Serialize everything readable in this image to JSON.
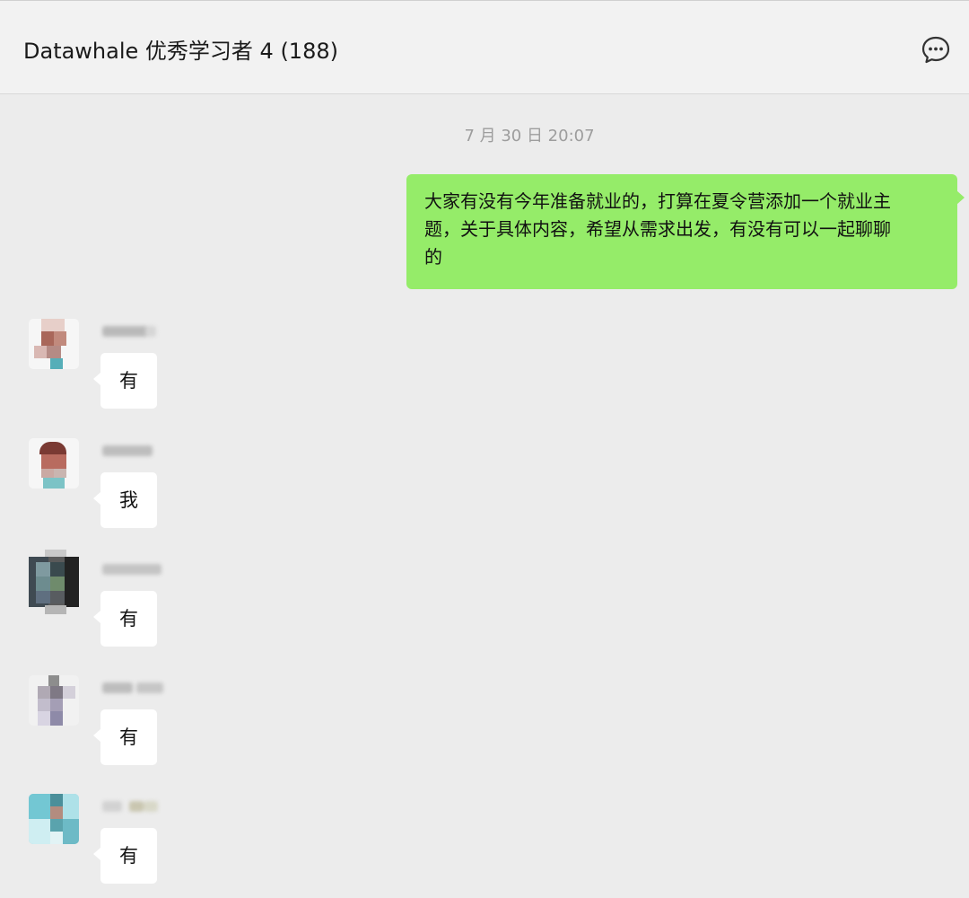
{
  "chat": {
    "title": "Datawhale 优秀学习者 4 (188)",
    "icons": [
      "more-options-icon"
    ]
  },
  "timestamp": "7 月 30 日 20:07",
  "outgoing_message": {
    "lines": [
      "大家有没有今年准备就业的，打算在夏令营添加一个就业主",
      "题，关于具体内容，希望从需求出发，有没有可以一起聊聊",
      "的"
    ]
  },
  "replies": [
    {
      "text": "有"
    },
    {
      "text": "我"
    },
    {
      "text": "有"
    },
    {
      "text": "有"
    },
    {
      "text": "有"
    }
  ]
}
